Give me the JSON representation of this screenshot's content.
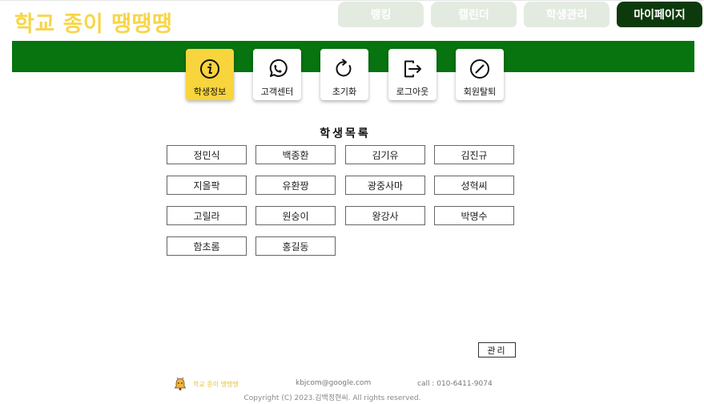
{
  "brand": "학교 종이 땡땡땡",
  "nav": {
    "tabs": [
      "랭킹",
      "캘린더",
      "학생관리",
      "마이페이지"
    ],
    "active_index": 3
  },
  "menu": {
    "items": [
      {
        "label": "학생정보",
        "icon": "info-icon"
      },
      {
        "label": "고객센터",
        "icon": "whatsapp-icon"
      },
      {
        "label": "초기화",
        "icon": "reset-icon"
      },
      {
        "label": "로그아웃",
        "icon": "logout-icon"
      },
      {
        "label": "회원탈퇴",
        "icon": "cancel-icon"
      }
    ],
    "active_index": 0
  },
  "section_title": "학생목록",
  "students": [
    "정민식",
    "백종환",
    "김기유",
    "김진규",
    "지올팍",
    "유환짱",
    "광중사마",
    "성혁씨",
    "고릴라",
    "원숭이",
    "왕강사",
    "박명수",
    "함초롬",
    "홍길동"
  ],
  "manage_label": "관리",
  "footer": {
    "name": "학교 종이 땡땡땡",
    "email": "kbjcom@google.com",
    "call": "call : 010-6411-9074",
    "copyright": "Copyright (C) 2023.김백정현씨. All rights reserved."
  },
  "colors": {
    "brand": "#f7d64a",
    "green_bar": "#07740f",
    "active_tab": "#0d3a0d",
    "inactive_tab": "#e3ebe1",
    "active_menu": "#f8d43d"
  }
}
